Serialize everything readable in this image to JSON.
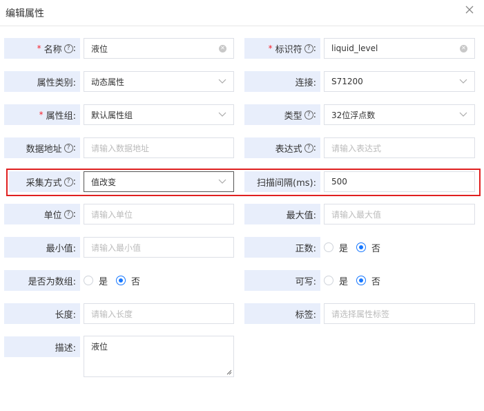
{
  "dialog": {
    "title": "编辑属性"
  },
  "fields": {
    "name": {
      "label": "名称",
      "value": "液位"
    },
    "identifier": {
      "label": "标识符",
      "value": "liquid_level"
    },
    "attr_category": {
      "label": "属性类别:",
      "value": "动态属性"
    },
    "connection": {
      "label": "连接:",
      "value": "S71200"
    },
    "attr_group": {
      "label": "属性组:",
      "value": "默认属性组"
    },
    "type": {
      "label": "类型",
      "value": "32位浮点数"
    },
    "data_address": {
      "label": "数据地址",
      "placeholder": "请输入数据地址"
    },
    "expression": {
      "label": "表达式",
      "placeholder": "请输入表达式"
    },
    "collect_mode": {
      "label": "采集方式",
      "value": "值改变"
    },
    "scan_interval": {
      "label": "扫描间隔(ms):",
      "value": "500"
    },
    "unit": {
      "label": "单位",
      "placeholder": "请输入单位"
    },
    "max_value": {
      "label": "最大值:",
      "placeholder": "请输入最大值"
    },
    "min_value": {
      "label": "最小值:",
      "placeholder": "请输入最小值"
    },
    "positive": {
      "label": "正数:",
      "options": [
        "是",
        "否"
      ],
      "selected": "否"
    },
    "is_array": {
      "label": "是否为数组:",
      "options": [
        "是",
        "否"
      ],
      "selected": "否"
    },
    "writable": {
      "label": "可写:",
      "options": [
        "是",
        "否"
      ],
      "selected": "否"
    },
    "length": {
      "label": "长度:",
      "placeholder": "请输入长度"
    },
    "tags": {
      "label": "标签:",
      "placeholder": "请选择属性标签"
    },
    "description": {
      "label": "描述:",
      "value": "液位"
    }
  },
  "colors": {
    "label_bg": "#e8eefb",
    "accent": "#1677ff",
    "required": "#f5222d",
    "highlight": "#e02020"
  }
}
